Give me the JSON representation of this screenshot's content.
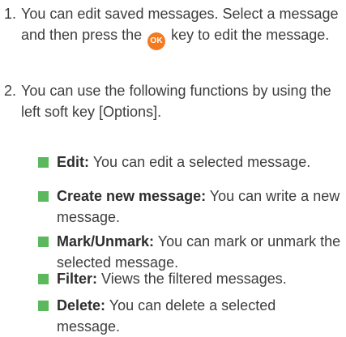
{
  "steps": [
    {
      "number": "1.",
      "text_before": "You can edit saved messages. Select a message and then press the",
      "key_label": "OK",
      "text_after": "key to edit the message."
    },
    {
      "number": "2.",
      "text": "You can use the following functions by using the left soft key [Options]."
    }
  ],
  "options": [
    {
      "term": "Edit:",
      "desc": "You can edit a selected message."
    },
    {
      "term": "Create new message:",
      "desc": "You can write a new message."
    },
    {
      "term": "Mark/Unmark:",
      "desc": "You can mark or unmark the selected message."
    },
    {
      "term": "Filter:",
      "desc": "Views the filtered messages."
    },
    {
      "term": "Delete:",
      "desc": "You can delete a selected message."
    }
  ],
  "colors": {
    "bullet": "#5cb85c",
    "ok_key": "#f47a20",
    "text": "#3d3d3d"
  }
}
